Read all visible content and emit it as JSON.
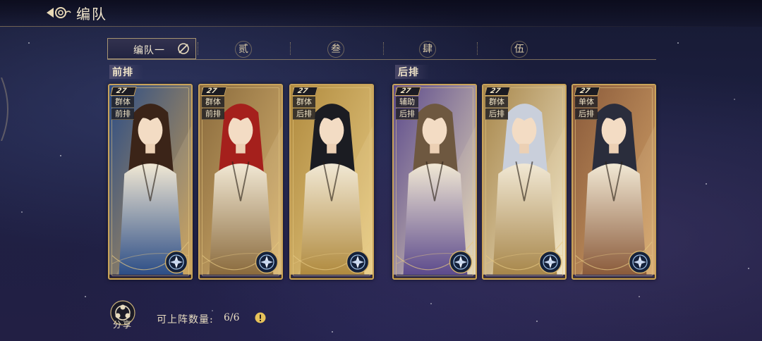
{
  "header": {
    "title": "编队",
    "back_icon": "cloud-back-icon"
  },
  "tabs": {
    "active_label": "编队一",
    "edit_icon": "edit-slash-icon",
    "items": [
      "贰",
      "叁",
      "肆",
      "伍"
    ]
  },
  "sections": {
    "front": "前排",
    "back": "后排"
  },
  "cards": [
    {
      "level": "27",
      "tag1": "群体",
      "tag2": "前排",
      "element_icon": "compass-emblem-icon",
      "palette": {
        "a": "#2c4d86",
        "b": "#c99d52",
        "hair": "#3b2418"
      }
    },
    {
      "level": "27",
      "tag1": "群体",
      "tag2": "前排",
      "element_icon": "compass-emblem-icon",
      "palette": {
        "a": "#8a6a3c",
        "b": "#d7b472",
        "hair": "#a5201c"
      }
    },
    {
      "level": "27",
      "tag1": "群体",
      "tag2": "后排",
      "element_icon": "compass-emblem-icon",
      "palette": {
        "a": "#b08a3e",
        "b": "#e8cc86",
        "hair": "#1b1c22"
      }
    },
    {
      "level": "27",
      "tag1": "辅助",
      "tag2": "后排",
      "element_icon": "compass-emblem-icon",
      "palette": {
        "a": "#5c4a8c",
        "b": "#e3d7b8",
        "hair": "#6e5840"
      }
    },
    {
      "level": "27",
      "tag1": "群体",
      "tag2": "后排",
      "element_icon": "compass-emblem-icon",
      "palette": {
        "a": "#a7864a",
        "b": "#efe4c8",
        "hair": "#c9cfdb"
      }
    },
    {
      "level": "27",
      "tag1": "单体",
      "tag2": "后排",
      "element_icon": "compass-emblem-icon",
      "palette": {
        "a": "#8a5a3a",
        "b": "#d4a46a",
        "hair": "#2a2d3c"
      }
    }
  ],
  "footer": {
    "share_label": "分享",
    "share_icon": "share-nodes-icon",
    "deploy_label": "可上阵数量:",
    "deploy_count": "6/6",
    "info_icon": "exclamation-info-icon"
  },
  "colors": {
    "gold": "#c9a35a",
    "accent_info": "#e6c25a"
  }
}
